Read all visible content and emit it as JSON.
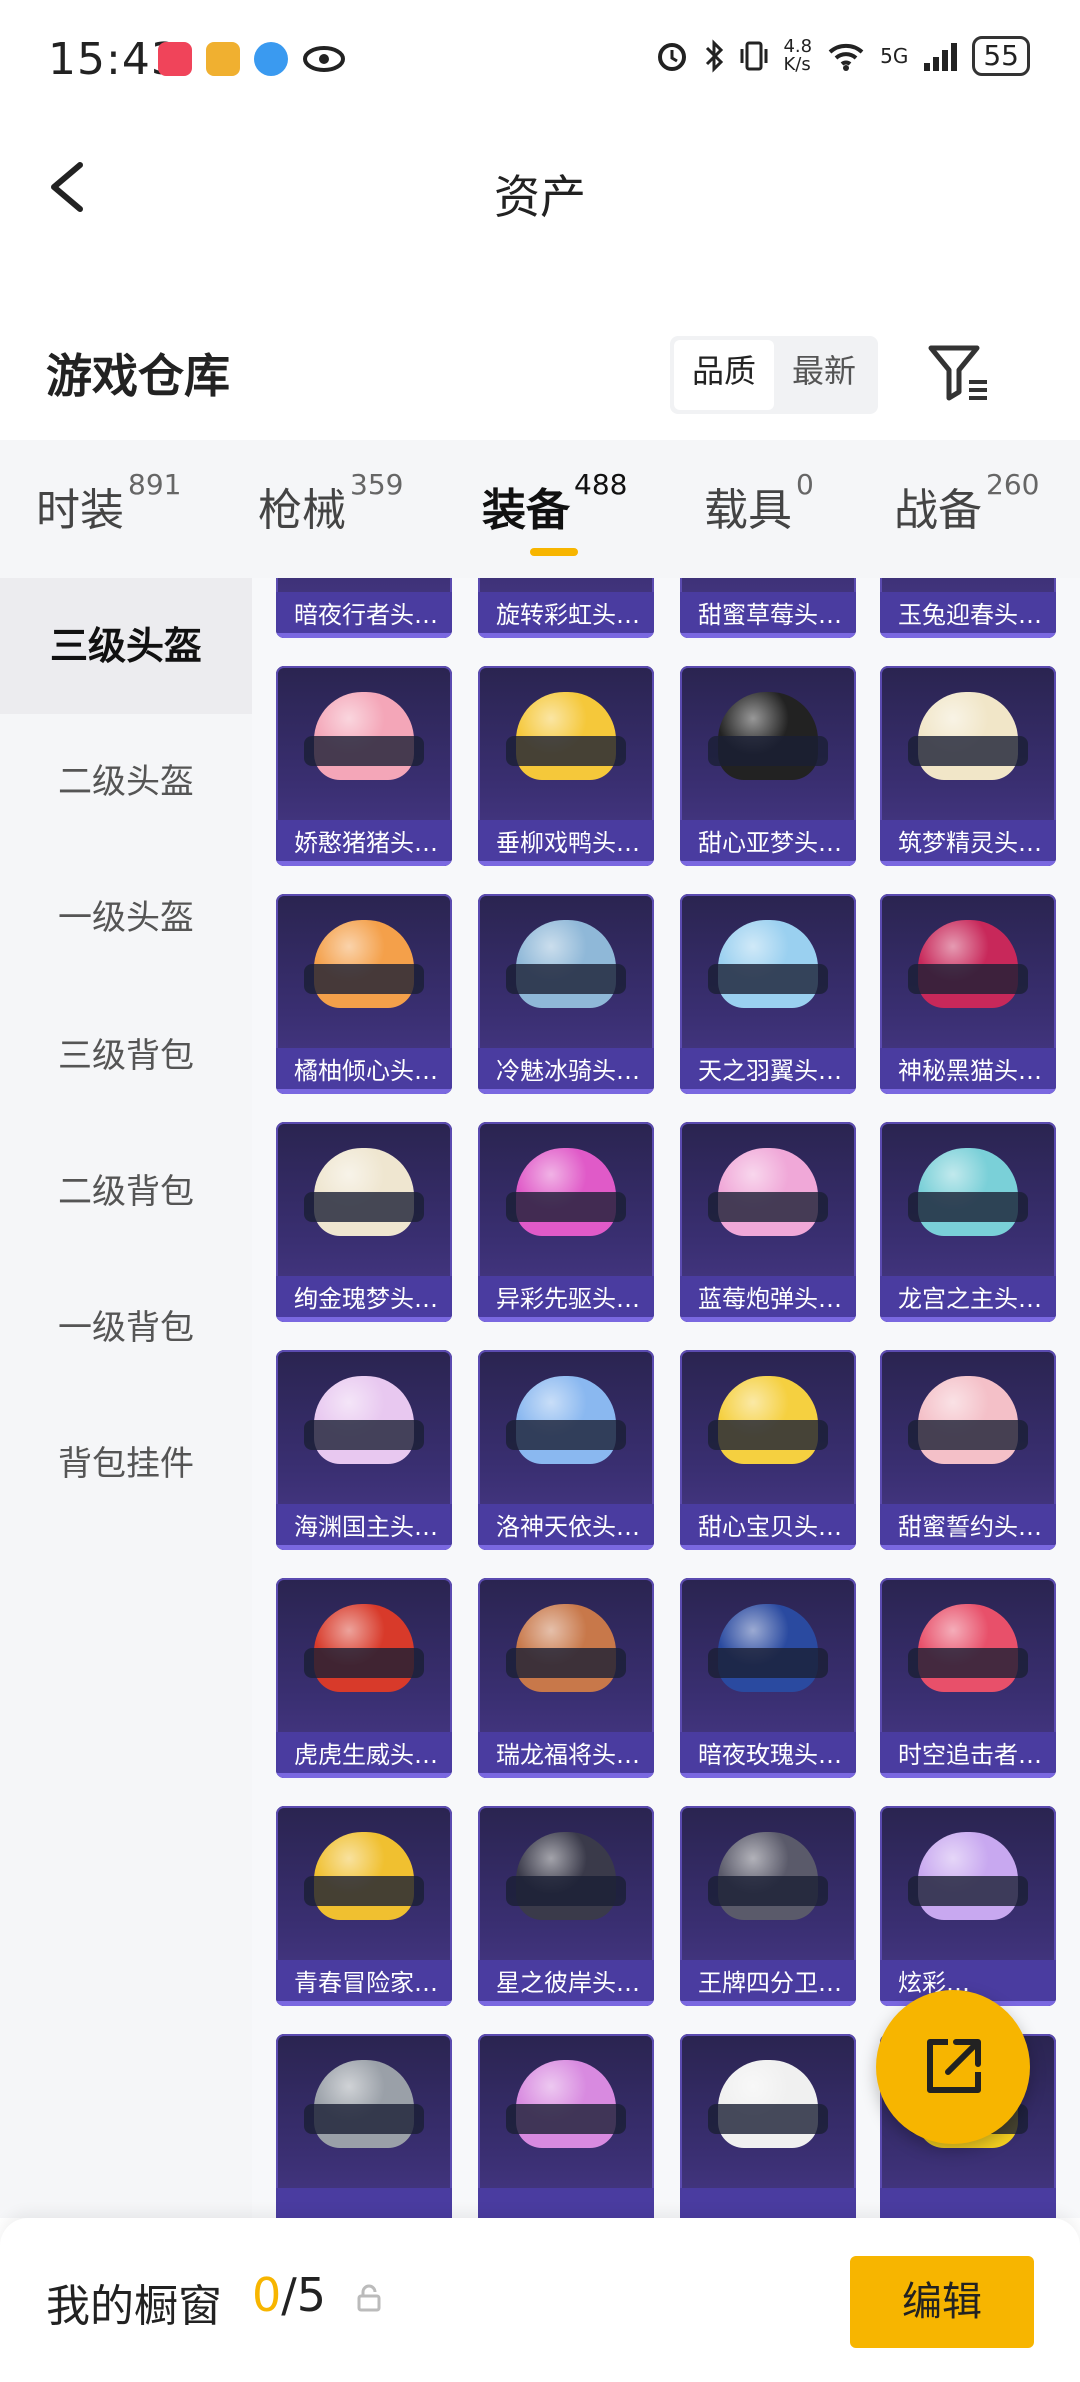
{
  "status_bar": {
    "time": "15:43",
    "network_speed": "4.8\nK/s",
    "network_type": "5G",
    "battery": "55"
  },
  "nav": {
    "title": "资产"
  },
  "header": {
    "title": "游戏仓库",
    "sort_options": [
      {
        "label": "品质",
        "active": true
      },
      {
        "label": "最新",
        "active": false
      }
    ]
  },
  "tabs": [
    {
      "label": "时装",
      "count": "891",
      "active": false
    },
    {
      "label": "枪械",
      "count": "359",
      "active": false
    },
    {
      "label": "装备",
      "count": "488",
      "active": true
    },
    {
      "label": "载具",
      "count": "0",
      "active": false
    },
    {
      "label": "战备",
      "count": "260",
      "active": false
    }
  ],
  "sidebar": {
    "items": [
      {
        "label": "三级头盔",
        "active": true
      },
      {
        "label": "二级头盔",
        "active": false
      },
      {
        "label": "一级头盔",
        "active": false
      },
      {
        "label": "三级背包",
        "active": false
      },
      {
        "label": "二级背包",
        "active": false
      },
      {
        "label": "一级背包",
        "active": false
      },
      {
        "label": "背包挂件",
        "active": false
      }
    ]
  },
  "items": [
    {
      "name": "暗夜行者头…",
      "color": "#3a2b2b"
    },
    {
      "name": "旋转彩虹头…",
      "color": "#c98a5a"
    },
    {
      "name": "甜蜜草莓头…",
      "color": "#b0713a"
    },
    {
      "name": "玉兔迎春头…",
      "color": "#8a3c2a"
    },
    {
      "name": "娇憨猪猪头…",
      "color": "#f4a6b8"
    },
    {
      "name": "垂柳戏鸭头…",
      "color": "#f5c83a"
    },
    {
      "name": "甜心亚梦头…",
      "color": "#222222"
    },
    {
      "name": "筑梦精灵头…",
      "color": "#f1e6c8"
    },
    {
      "name": "橘柚倾心头…",
      "color": "#f4a04a"
    },
    {
      "name": "冷魅冰骑头…",
      "color": "#8fb8d8"
    },
    {
      "name": "天之羽翼头…",
      "color": "#9ad0f0"
    },
    {
      "name": "神秘黑猫头…",
      "color": "#c8285a"
    },
    {
      "name": "绚金瑰梦头…",
      "color": "#efe6d0"
    },
    {
      "name": "异彩先驱头…",
      "color": "#e05ac8"
    },
    {
      "name": "蓝莓炮弹头…",
      "color": "#f0a8d8"
    },
    {
      "name": "龙宫之主头…",
      "color": "#7ad0d8"
    },
    {
      "name": "海渊国主头…",
      "color": "#e8c8f0"
    },
    {
      "name": "洛神天依头…",
      "color": "#8ab8f0"
    },
    {
      "name": "甜心宝贝头…",
      "color": "#f5d040"
    },
    {
      "name": "甜蜜誓约头…",
      "color": "#f4c0c8"
    },
    {
      "name": "虎虎生威头…",
      "color": "#d83a2a"
    },
    {
      "name": "瑞龙福将头…",
      "color": "#c8784a"
    },
    {
      "name": "暗夜玫瑰头…",
      "color": "#2a4aa0"
    },
    {
      "name": "时空追击者…",
      "color": "#e8506a"
    },
    {
      "name": "青春冒险家…",
      "color": "#f0c030"
    },
    {
      "name": "星之彼岸头…",
      "color": "#3a3a4a"
    },
    {
      "name": "王牌四分卫…",
      "color": "#5a5a6a"
    },
    {
      "name": "炫彩…",
      "color": "#c8a8f0"
    },
    {
      "name": "",
      "color": "#9aa0a8"
    },
    {
      "name": "",
      "color": "#d88ae0"
    },
    {
      "name": "",
      "color": "#f0f0f0"
    },
    {
      "name": "",
      "color": "#f5d020"
    }
  ],
  "showcase": {
    "label": "我的橱窗",
    "current": "0",
    "separator": "/",
    "max": "5",
    "edit_label": "编辑"
  },
  "colors": {
    "accent": "#f7b500",
    "card_bg": "#3a2f72",
    "card_label_bg": "#4a3ca0"
  }
}
